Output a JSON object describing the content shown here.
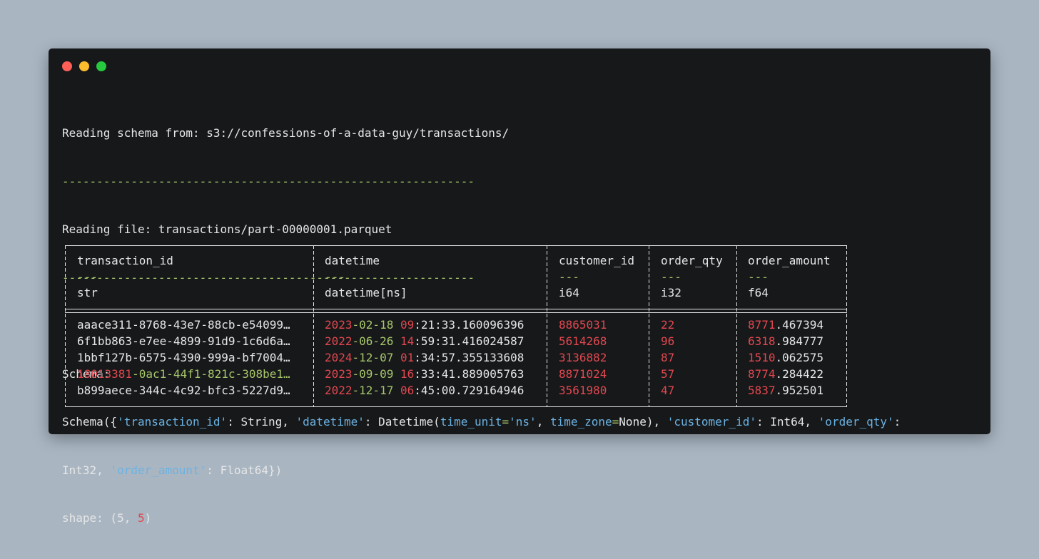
{
  "window": {
    "traffic_lights": {
      "close": "#ff5f56",
      "minimize": "#ffbd2e",
      "maximize": "#27c93f"
    }
  },
  "log": {
    "reading_schema": "Reading schema from: s3://confessions-of-a-data-guy/transactions/",
    "separator": "------------------------------------------------------------",
    "reading_file": "Reading file: transactions/part-00000001.parquet",
    "schema_label": "Schema:",
    "schema_line1": {
      "p1": "Schema({",
      "k1": "'transaction_id'",
      "p2": ": String, ",
      "k2": "'datetime'",
      "p3": ": Datetime(",
      "k3": "time_unit",
      "eq1": "=",
      "k4": "'ns'",
      "p4": ", ",
      "k5": "time_zone",
      "eq2": "=",
      "p5": "None), ",
      "k6": "'customer_id'",
      "p6": ": Int64, ",
      "k7": "'order_qty'",
      "p7": ":"
    },
    "schema_line2": {
      "p1": "Int32, ",
      "k1": "'order_amount'",
      "p2": ": Float64})"
    },
    "shape": {
      "prefix": "shape: (",
      "rows": "5",
      "sep": ", ",
      "cols": "5",
      "suffix": ")"
    }
  },
  "table": {
    "columns": [
      {
        "name": "transaction_id",
        "dashes": "---",
        "dtype": "str"
      },
      {
        "name": "datetime",
        "dashes": "---",
        "dtype": "datetime[ns]"
      },
      {
        "name": "customer_id",
        "dashes": "---",
        "dtype": "i64"
      },
      {
        "name": "order_qty",
        "dashes": "---",
        "dtype": "i32"
      },
      {
        "name": "order_amount",
        "dashes": "---",
        "dtype": "f64"
      }
    ],
    "rows": [
      {
        "id": "aaace311-8768-43e7-88cb-e54099…",
        "d_year": "2023",
        "d_rest": "-02-18",
        "d_hour": "09",
        "d_time": ":21:33.160096396",
        "cust": "8865031",
        "qty": "22",
        "amt_int": "8771",
        "amt_dec": ".467394"
      },
      {
        "id": "6f1bb863-e7ee-4899-91d9-1c6d6a…",
        "d_year": "2022",
        "d_rest": "-06-26",
        "d_hour": "14",
        "d_time": ":59:31.416024587",
        "cust": "5614268",
        "qty": "96",
        "amt_int": "6318",
        "amt_dec": ".984777"
      },
      {
        "id": "1bbf127b-6575-4390-999a-bf7004…",
        "d_year": "2024",
        "d_rest": "-12-07",
        "d_hour": "01",
        "d_time": ":34:57.355133608",
        "cust": "3136882",
        "qty": "87",
        "amt_int": "1510",
        "amt_dec": ".062575"
      },
      {
        "id_num": "18013381",
        "id_rest": "-0ac1-44f1-821c-308be1…",
        "d_year": "2023",
        "d_rest": "-09-09",
        "d_hour": "16",
        "d_time": ":33:41.889005763",
        "cust": "8871024",
        "qty": "57",
        "amt_int": "8774",
        "amt_dec": ".284422"
      },
      {
        "id": "b899aece-344c-4c92-bfc3-5227d9…",
        "d_year": "2022",
        "d_rest": "-12-17",
        "d_hour": "06",
        "d_time": ":45:00.729164946",
        "cust": "3561980",
        "qty": "47",
        "amt_int": "5837",
        "amt_dec": ".952501"
      }
    ]
  }
}
